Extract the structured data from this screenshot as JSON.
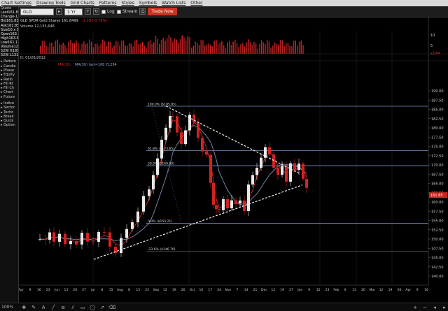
{
  "menu": [
    "Chart Settings",
    "Drawing Tools",
    "Grid Charts",
    "Patterns",
    "Styles",
    "Symbols",
    "Watch Lists",
    "Other"
  ],
  "toolbar": {
    "symbol": "GLD",
    "period": "1 Yr",
    "log_label": "Log",
    "stream_label": "Stream",
    "trade_label": "Trade Now"
  },
  "left_panel": {
    "quote_header": "Quote",
    "quote_rows": [
      {
        "label": "Last",
        "value": "161.8499"
      },
      {
        "label": "Change",
        "value": "-1.29"
      },
      {
        "label": "Bid",
        "value": "161.83"
      },
      {
        "label": "Ask",
        "value": "161.85"
      },
      {
        "label": "Size",
        "value": "10 x 12"
      },
      {
        "label": "Open",
        "value": "163.35"
      },
      {
        "label": "High",
        "value": "163.41"
      },
      {
        "label": "Low",
        "value": "161.11"
      },
      {
        "label": "Volume",
        "value": "12.16M"
      },
      {
        "label": "52W H",
        "value": "185.85"
      },
      {
        "label": "52W L",
        "value": "131.94"
      }
    ],
    "sections_a": [
      "Pattern",
      "Candle",
      "Phase",
      "Equity",
      "Ratio",
      "Fill Rt",
      "Fill Ch",
      "Chart",
      "Future"
    ],
    "sections_b": [
      "Indice",
      "Sector",
      "Techn",
      "Break",
      "Quick",
      "Option"
    ]
  },
  "chart": {
    "header": "GLD SPDR Gold Shares  161.8499",
    "header_change": "-1.29 (-0.79%)",
    "volume_label": "Volume 12,155,648",
    "date_label": "D: 01/26/2012",
    "ma_label": "MA(10)",
    "ma_last": "MA(30) last=168.71284",
    "fib_labels": [
      {
        "text": "100.0% ($185.85)",
        "price": 185.85
      },
      {
        "text": "61.8% ($173.85)",
        "price": 173.85
      },
      {
        "text": "50.0% ($169.80)",
        "price": 169.8
      },
      {
        "text": "0.0% ($154.21)",
        "price": 154.21
      },
      {
        "text": "-23.6% ($146.70)",
        "price": 146.7
      }
    ],
    "price_axis": [
      "190.00",
      "187.50",
      "185.00",
      "182.50",
      "180.00",
      "177.50",
      "175.00",
      "172.50",
      "170.00",
      "167.50",
      "165.00",
      "162.50",
      "160.00",
      "157.50",
      "155.00",
      "152.50",
      "150.00",
      "147.50",
      "145.00",
      "142.50",
      "140.00"
    ],
    "last_price_tag": "161.85",
    "volume_axis": [
      "10",
      "5"
    ],
    "volume_unit": "x10M",
    "date_axis": [
      "Apr",
      "9",
      "16",
      "23",
      "Jun",
      "13",
      "20",
      "27",
      "Jul",
      "8",
      "15",
      "Aug",
      "8",
      "15",
      "22",
      "Sep",
      "12",
      "19",
      "26",
      "Oct",
      "10",
      "17",
      "24",
      "Nov",
      "7",
      "14",
      "21",
      "Dec",
      "12",
      "19",
      "27",
      "Jan",
      "9",
      "16",
      "23",
      "Feb",
      "6",
      "13",
      "20",
      "Mar",
      "12",
      "19",
      "26",
      "Apr",
      "9",
      "16"
    ]
  },
  "bottom_bar": {
    "zoom_pct": "100%"
  },
  "colors": {
    "up_candle": "#e8e8e8",
    "down_candle": "#d22222",
    "ma_fast": "#cc2b2b",
    "ma_slow": "#7f8fb0",
    "fib_line": "#7596c7",
    "trendline": "#f2f2f2"
  },
  "icons": [
    "crosshair-icon",
    "pencil-icon",
    "text-icon",
    "line-icon",
    "fib-icon",
    "zoom-in-icon",
    "zoom-out-icon",
    "print-icon"
  ]
}
